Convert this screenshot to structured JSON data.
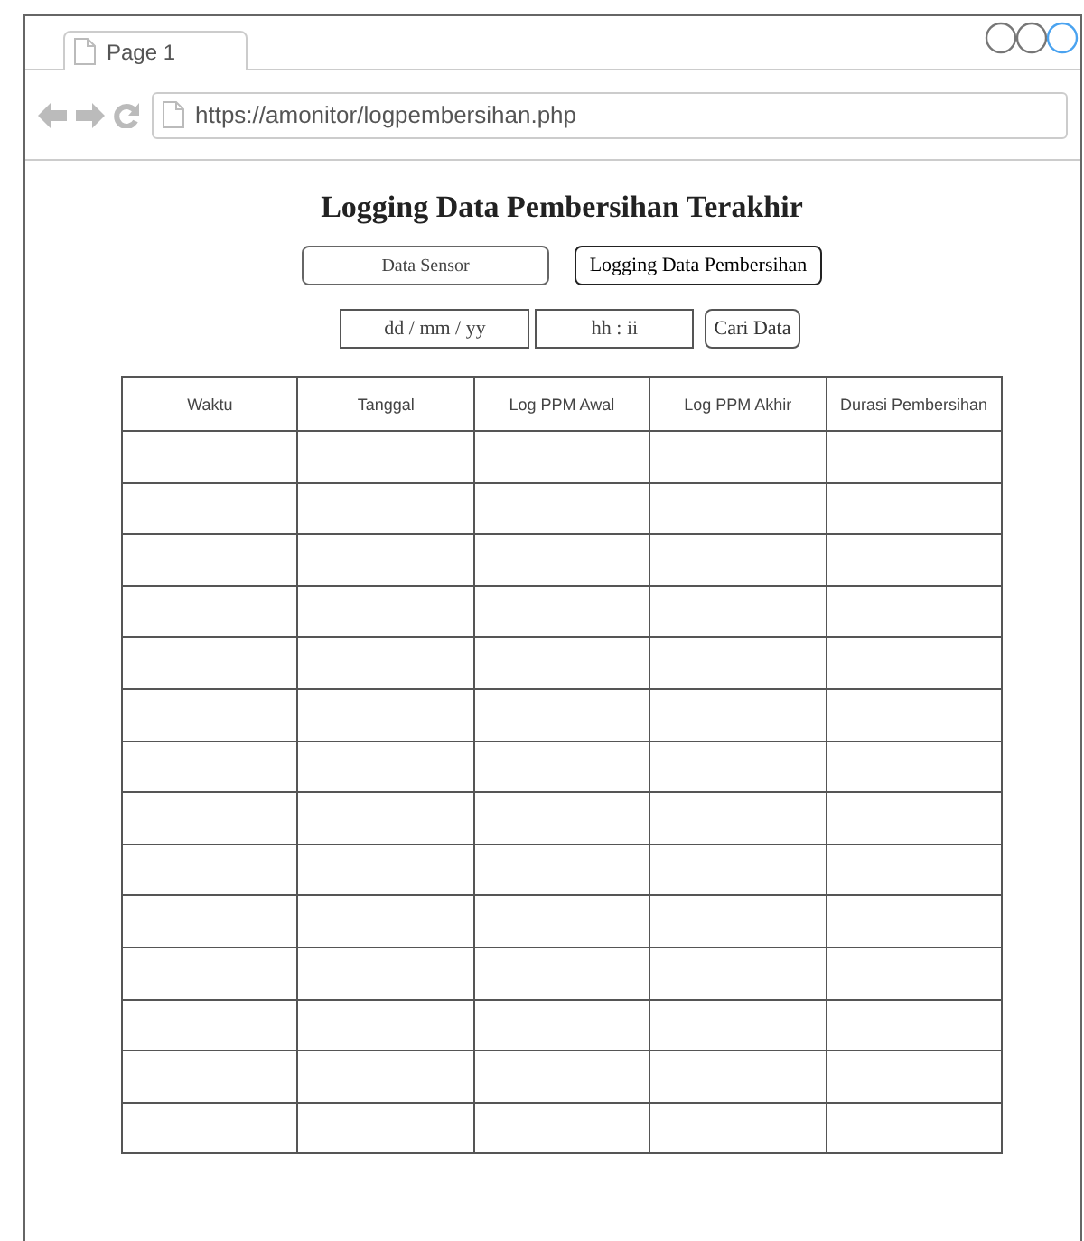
{
  "browser": {
    "tab": "Page 1",
    "url": "https://amonitor/logpembersihan.php"
  },
  "page": {
    "title": "Logging Data Pembersihan Terakhir",
    "nav_buttons": [
      {
        "label": "Data Sensor",
        "selected": false
      },
      {
        "label": "Logging Data Pembersihan",
        "selected": true
      }
    ],
    "date_field": {
      "placeholder": "dd / mm / yy"
    },
    "time_field": {
      "placeholder": "hh : ii"
    },
    "search_button": "Cari Data"
  },
  "table": {
    "columns": [
      "Waktu",
      "Tanggal",
      "Log PPM Awal",
      "Log PPM Akhir",
      "Durasi Pembersihan"
    ]
  }
}
